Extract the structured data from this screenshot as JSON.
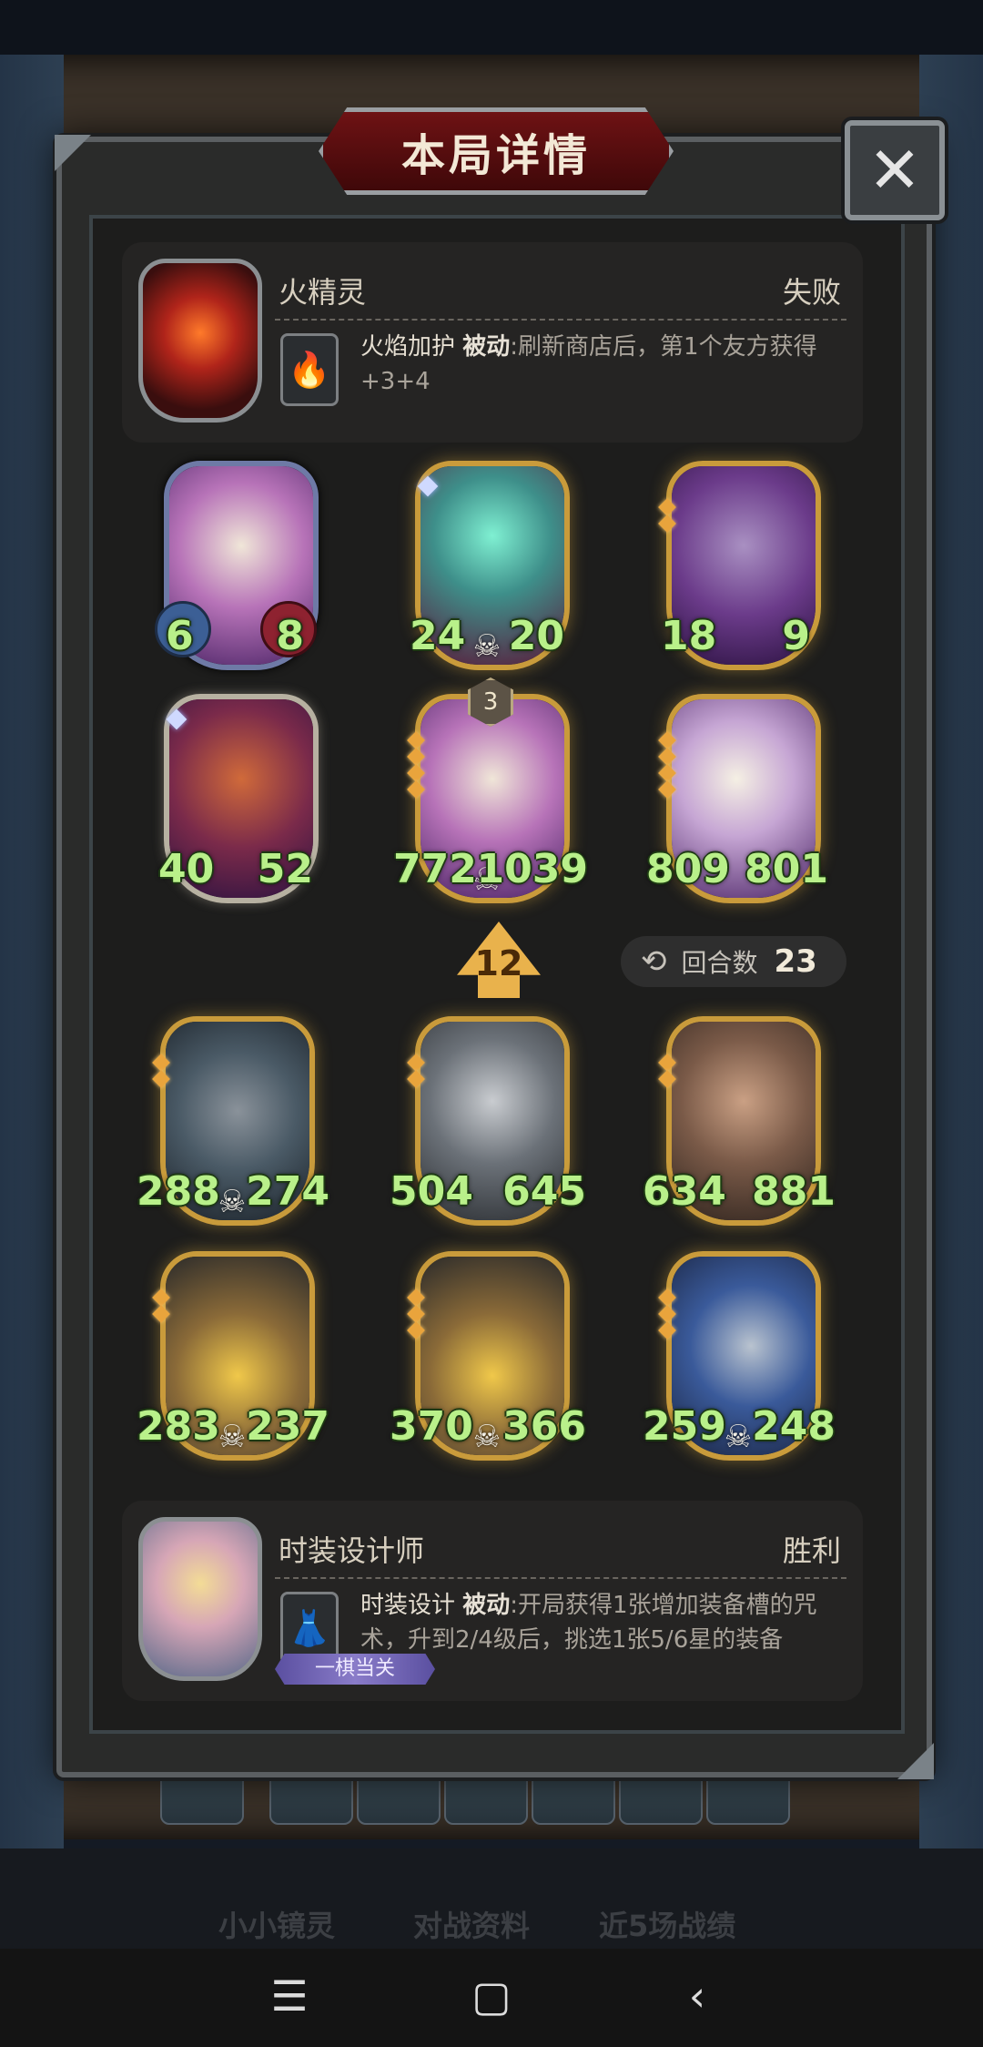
{
  "modal": {
    "title": "本局详情"
  },
  "opponent": {
    "name": "火精灵",
    "result": "失败",
    "skill_name": "火焰加护",
    "skill_type": "被动",
    "skill_desc": ":刷新商店后，第1个友方获得+3+4"
  },
  "opponent_units": [
    {
      "atk": "6",
      "hp": "8"
    },
    {
      "atk": "24",
      "hp": "20"
    },
    {
      "atk": "18",
      "hp": "9"
    },
    {
      "atk": "40",
      "hp": "52"
    },
    {
      "atk": "772",
      "hp": "1039",
      "level": "3"
    },
    {
      "atk": "809",
      "hp": "801"
    }
  ],
  "info": {
    "level": "12",
    "rounds_label": "回合数",
    "rounds": "23"
  },
  "player_units": [
    {
      "atk": "288",
      "hp": "274"
    },
    {
      "atk": "504",
      "hp": "645"
    },
    {
      "atk": "634",
      "hp": "881"
    },
    {
      "atk": "283",
      "hp": "237"
    },
    {
      "atk": "370",
      "hp": "366"
    },
    {
      "atk": "259",
      "hp": "248"
    }
  ],
  "player": {
    "name": "时装设计师",
    "result": "胜利",
    "skill_name": "时装设计",
    "skill_type": "被动",
    "skill_desc": ":开局获得1张增加装备槽的咒术，升到2/4级后，挑选1张5/6星的装备",
    "badge": "一棋当关"
  },
  "bottom_tabs": [
    "小小镜灵",
    "对战资料",
    "近5场战绩"
  ],
  "colors": {
    "stat_green": "#b9f08a",
    "gold_frame": "#c99b3b",
    "title_red": "#6e1214"
  }
}
